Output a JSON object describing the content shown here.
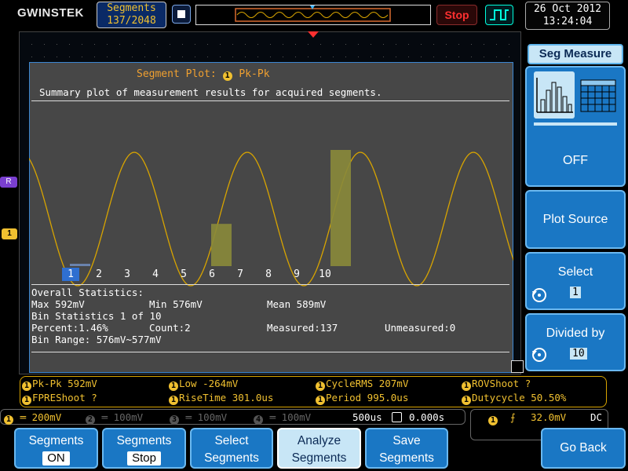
{
  "brand": "GWINSTEK",
  "segments_display": {
    "label": "Segments",
    "value": "137/2048"
  },
  "run_state": "Stop",
  "datetime": {
    "date": "26 Oct 2012",
    "time": "13:24:04"
  },
  "colors": {
    "ch1": "#f0c030",
    "menu_blue": "#1a77c4",
    "panel_gray": "#474747",
    "stop_red": "#ff3030"
  },
  "segment_plot": {
    "title_prefix": "Segment Plot:",
    "channel": "1",
    "measurement": "Pk-Pk",
    "description": "Summary plot of measurement results for acquired segments.",
    "bins": [
      "1",
      "2",
      "3",
      "4",
      "5",
      "6",
      "7",
      "8",
      "9",
      "10"
    ],
    "selected_bin": "1",
    "bin_counts": [
      2,
      0,
      0,
      0,
      0,
      36,
      0,
      0,
      0,
      99
    ]
  },
  "stats": {
    "overall_title": "Overall Statistics:",
    "max": "Max 592mV",
    "min": "Min 576mV",
    "mean": "Mean 589mV",
    "bin_title": "Bin Statistics  1 of 10",
    "percent": "Percent:1.46%",
    "count": "Count:2",
    "measured": "Measured:137",
    "unmeasured": "Unmeasured:0",
    "bin_range": "Bin Range:  576mV~577mV"
  },
  "right_menu": {
    "title": "Seg Measure",
    "plot_state": "OFF",
    "plot_source": "Plot Source",
    "select_label": "Select",
    "select_value": "1",
    "divided_label": "Divided by",
    "divided_value": "10",
    "icons": [
      "histogram-icon",
      "table-icon"
    ]
  },
  "measurements": [
    {
      "ch": "1",
      "text": "Pk-Pk 592mV"
    },
    {
      "ch": "1",
      "text": "Low -264mV"
    },
    {
      "ch": "1",
      "text": "CycleRMS 207mV"
    },
    {
      "ch": "1",
      "text": "ROVShoot ?"
    },
    {
      "ch": "1",
      "text": "FPREShoot ?"
    },
    {
      "ch": "1",
      "text": "RiseTime 301.0us"
    },
    {
      "ch": "1",
      "text": "Period 995.0us"
    },
    {
      "ch": "1",
      "text": "Dutycycle 50.50%"
    }
  ],
  "channel_status": {
    "ch1": {
      "num": "1",
      "scale": "200mV"
    },
    "ch2": {
      "num": "2",
      "scale": "100mV"
    },
    "ch3": {
      "num": "3",
      "scale": "100mV"
    },
    "ch4": {
      "num": "4",
      "scale": "100mV"
    },
    "timebase": "500us",
    "position": "0.000s"
  },
  "trigger": {
    "ch": "1",
    "level": "32.0mV",
    "coupling": "DC"
  },
  "markers": {
    "ch1": "1",
    "ref": "R"
  },
  "bottom_menu": [
    {
      "line1": "Segments",
      "line2": "ON",
      "tag": true
    },
    {
      "line1": "Segments",
      "line2": "Stop",
      "tag": true
    },
    {
      "line1": "Select",
      "line2": "Segments",
      "tag": false
    },
    {
      "line1": "Analyze",
      "line2": "Segments",
      "tag": false,
      "selected": true
    },
    {
      "line1": "Save",
      "line2": "Segments",
      "tag": false
    },
    {
      "line1": "Go Back",
      "line2": "",
      "tag": false
    }
  ]
}
